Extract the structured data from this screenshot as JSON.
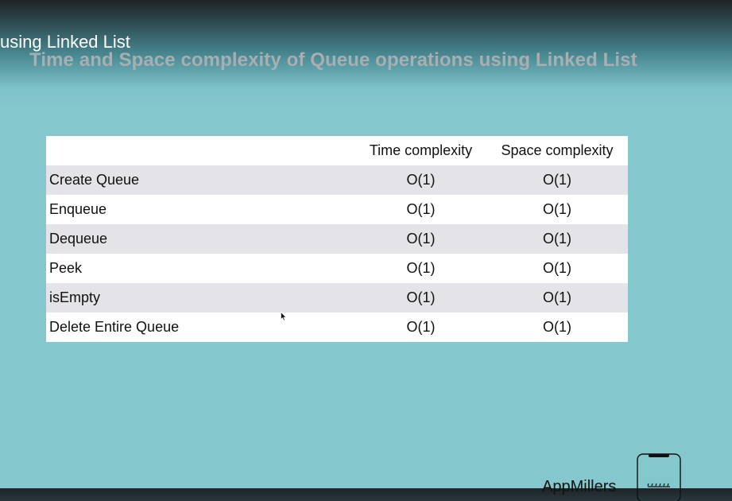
{
  "video": {
    "title_fragment": "using Linked List"
  },
  "slide": {
    "title": "Time and Space complexity of Queue operations using Linked List",
    "table": {
      "headers": [
        "",
        "Time complexity",
        "Space complexity"
      ],
      "rows": [
        {
          "operation": "Create Queue",
          "time": "O(1)",
          "space": "O(1)"
        },
        {
          "operation": "Enqueue",
          "time": "O(1)",
          "space": "O(1)"
        },
        {
          "operation": "Dequeue",
          "time": "O(1)",
          "space": "O(1)"
        },
        {
          "operation": "Peek",
          "time": "O(1)",
          "space": "O(1)"
        },
        {
          "operation": "isEmpty",
          "time": "O(1)",
          "space": "O(1)"
        },
        {
          "operation": "Delete Entire Queue",
          "time": "O(1)",
          "space": "O(1)"
        }
      ]
    }
  },
  "branding": {
    "name": "AppMillers",
    "logo_icon": "phone-logo-icon"
  },
  "icons": {
    "cursor": "cursor-icon"
  },
  "colors": {
    "background": "#84c7cd",
    "header_dark": "#1f2326",
    "title_gray": "#a8aeb2",
    "row_stripe": "#e3e3e8",
    "row_white": "#ffffff"
  }
}
